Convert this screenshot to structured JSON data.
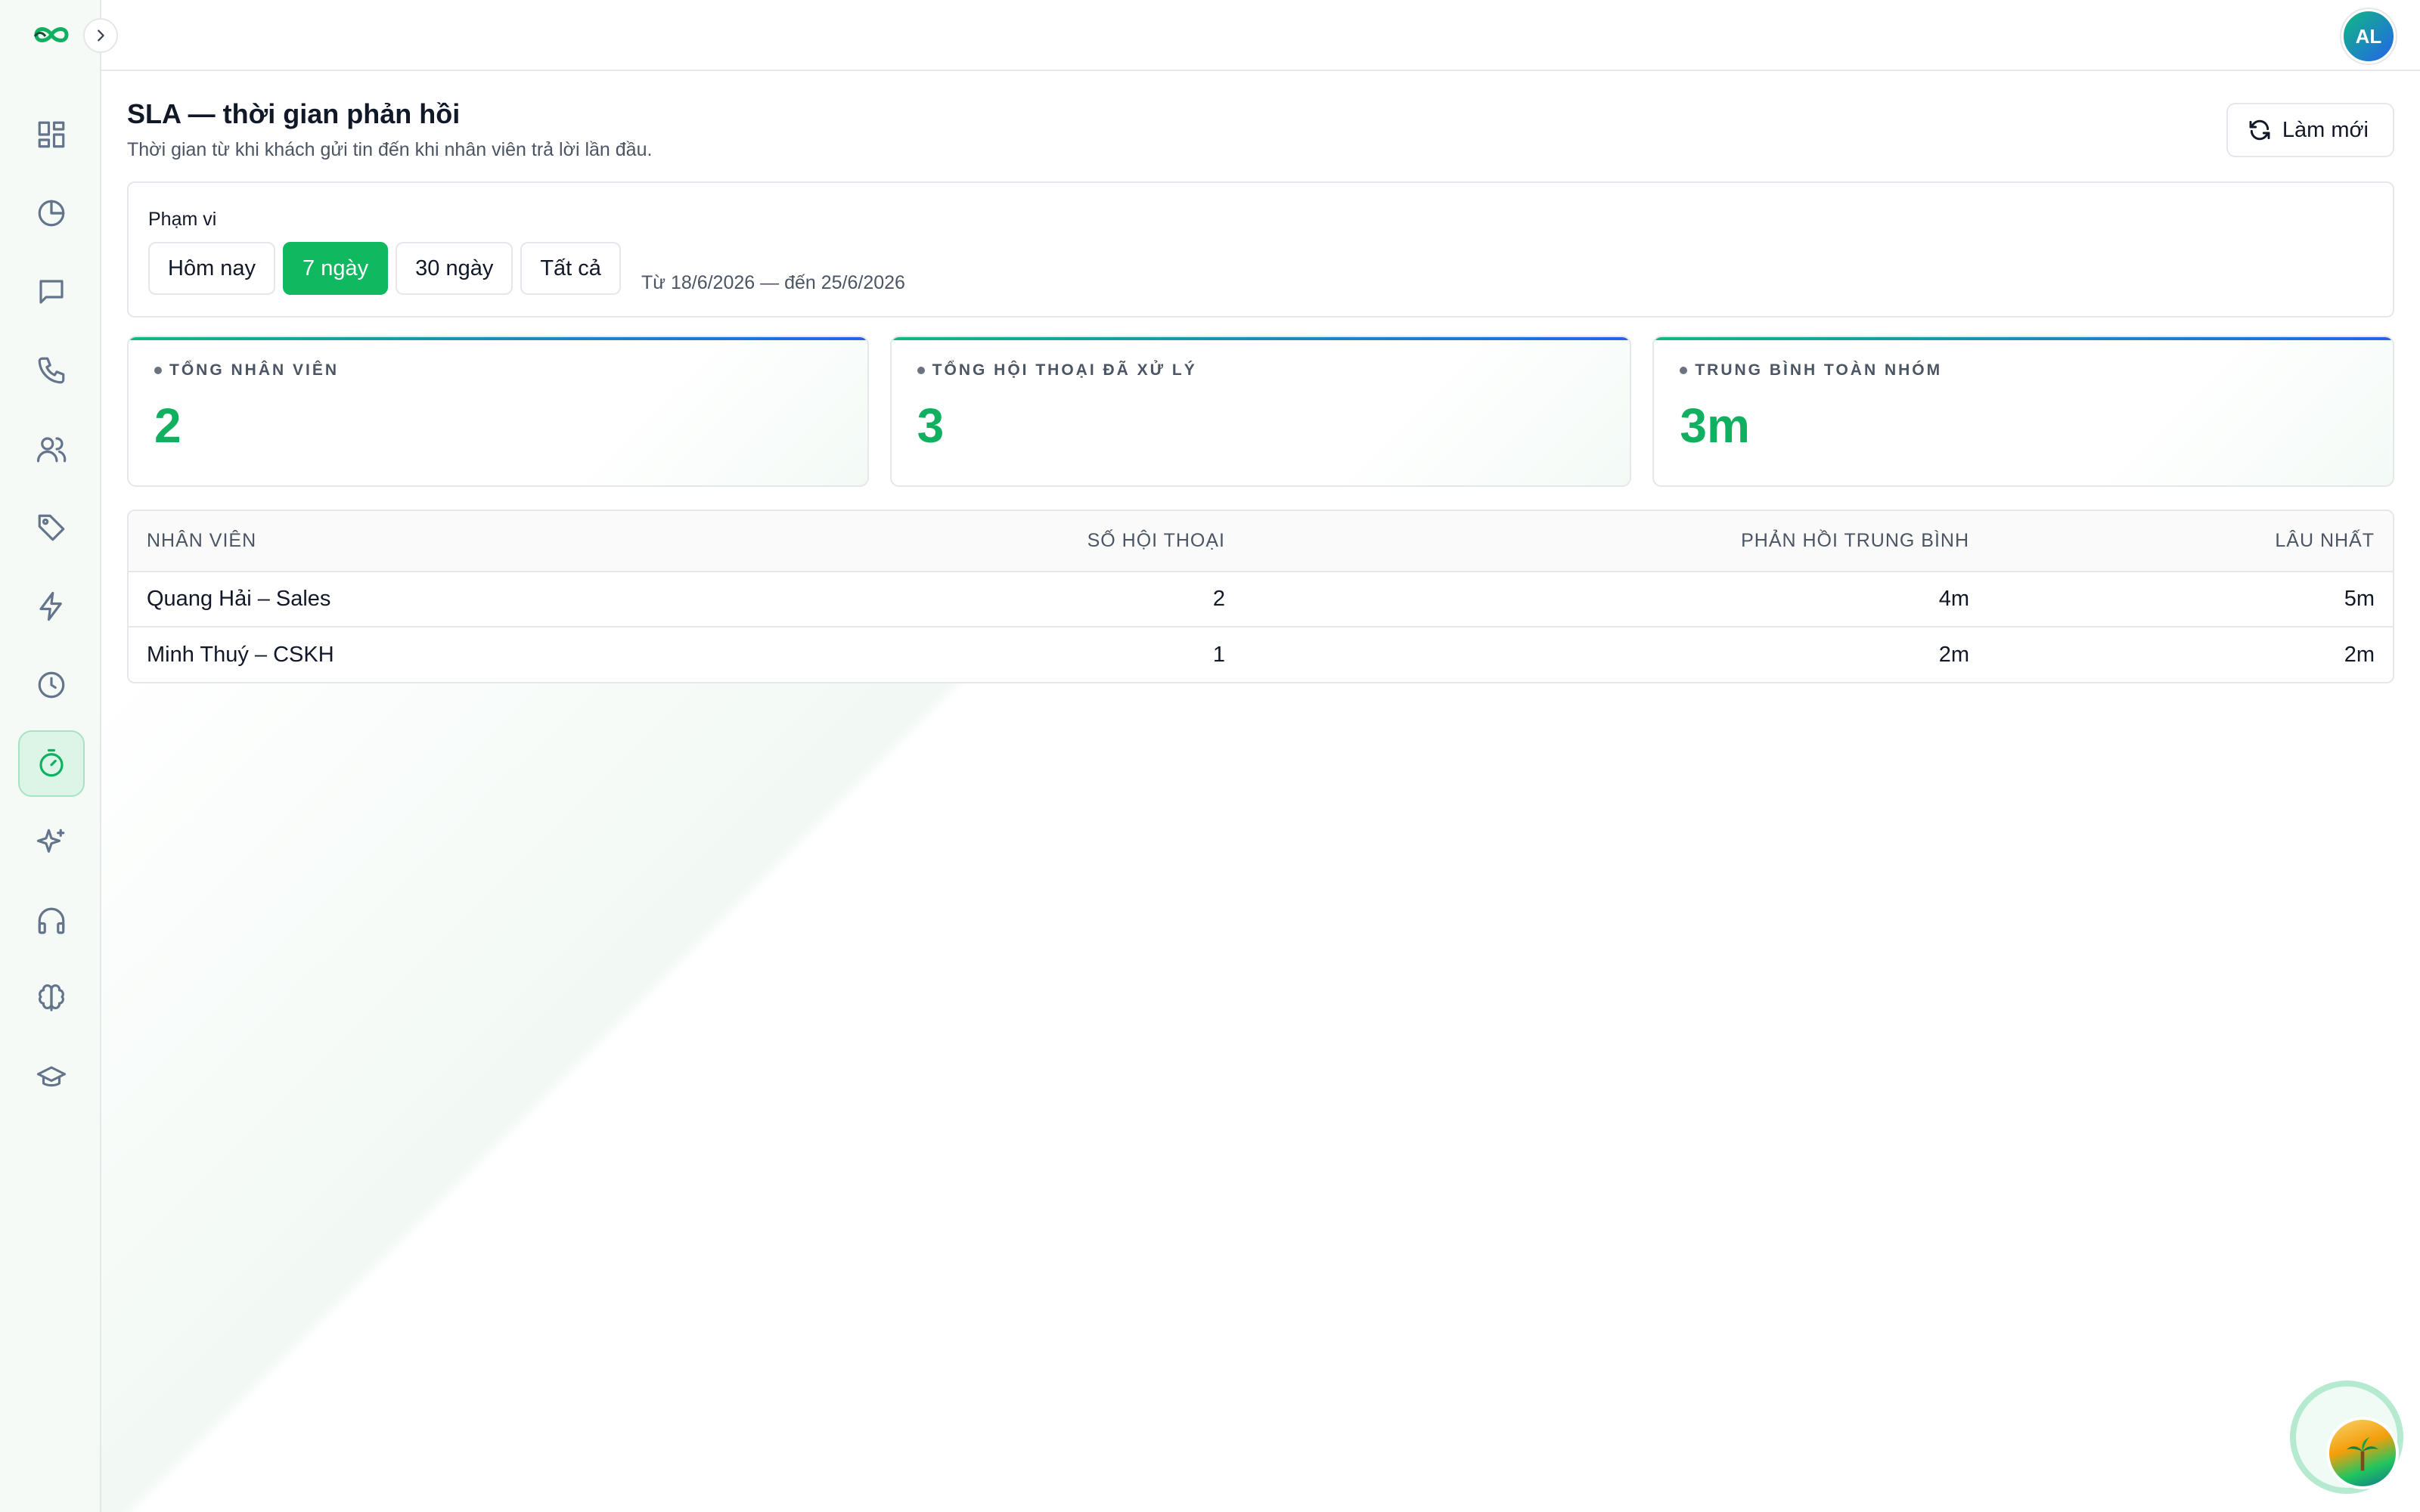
{
  "user": {
    "initials": "AL"
  },
  "page": {
    "title": "SLA — thời gian phản hồi",
    "subtitle": "Thời gian từ khi khách gửi tin đến khi nhân viên trả lời lần đầu.",
    "refresh_label": "Làm mới"
  },
  "filter": {
    "label": "Phạm vi",
    "options": [
      "Hôm nay",
      "7 ngày",
      "30 ngày",
      "Tất cả"
    ],
    "selected": "7 ngày",
    "range_text": "Từ 18/6/2026 — đến 25/6/2026"
  },
  "stats": [
    {
      "label": "TỔNG NHÂN VIÊN",
      "value": "2"
    },
    {
      "label": "TỔNG HỘI THOẠI ĐÃ XỬ LÝ",
      "value": "3"
    },
    {
      "label": "TRUNG BÌNH TOÀN NHÓM",
      "value": "3m"
    }
  ],
  "table": {
    "headers": [
      "NHÂN VIÊN",
      "SỐ HỘI THOẠI",
      "PHẢN HỒI TRUNG BÌNH",
      "LÂU NHẤT"
    ],
    "rows": [
      [
        "Quang Hải – Sales",
        "2",
        "4m",
        "5m"
      ],
      [
        "Minh Thuý – CSKH",
        "1",
        "2m",
        "2m"
      ]
    ]
  },
  "sidebar": {
    "icons": [
      "dashboard-icon",
      "pie-chart-icon",
      "chat-icon",
      "phone-icon",
      "users-icon",
      "tag-icon",
      "zap-icon",
      "clock-icon",
      "timer-icon",
      "sparkles-icon",
      "headphones-icon",
      "brain-icon",
      "graduation-cap-icon"
    ],
    "active": "timer-icon"
  },
  "colors": {
    "accent": "#10b960",
    "gradient_start": "#10b981",
    "gradient_end": "#2563eb"
  }
}
